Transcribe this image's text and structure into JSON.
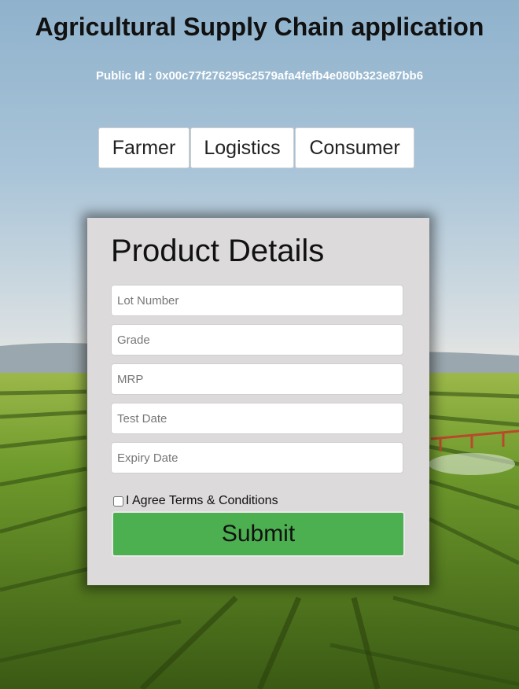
{
  "header": {
    "title": "Agricultural Supply Chain application",
    "public_id": "Public Id : 0x00c77f276295c2579afa4fefb4e080b323e87bb6"
  },
  "tabs": [
    {
      "label": "Farmer"
    },
    {
      "label": "Logistics"
    },
    {
      "label": "Consumer"
    }
  ],
  "form": {
    "title": "Product Details",
    "fields": [
      {
        "placeholder": "Lot Number",
        "value": ""
      },
      {
        "placeholder": "Grade",
        "value": ""
      },
      {
        "placeholder": "MRP",
        "value": ""
      },
      {
        "placeholder": "Test Date",
        "value": ""
      },
      {
        "placeholder": "Expiry Date",
        "value": ""
      }
    ],
    "agree_label": "I Agree Terms & Conditions",
    "agree_checked": false,
    "submit_label": "Submit"
  },
  "colors": {
    "submit": "#4caf50",
    "card": "#dcdadb",
    "sky": "#a9c4d6",
    "field_crop": "#6f9a2c"
  }
}
